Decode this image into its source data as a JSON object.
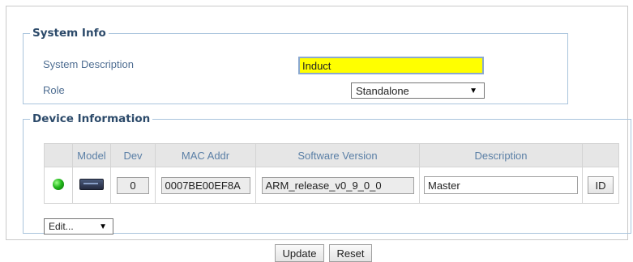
{
  "system_info": {
    "legend": "System Info",
    "system_description_label": "System Description",
    "system_description_value": "Induct",
    "role_label": "Role",
    "role_selected": "Standalone"
  },
  "device_information": {
    "legend": "Device Information",
    "columns": [
      "",
      "Model",
      "Dev",
      "MAC Addr",
      "Software Version",
      "Description",
      ""
    ],
    "rows": [
      {
        "status": "online",
        "status_color": "#22b81b",
        "model_icon": "device-model-icon",
        "dev": "0",
        "mac": "0007BE00EF8A",
        "software_version": "ARM_release_v0_9_0_0",
        "description": "Master",
        "id_button": "ID"
      }
    ],
    "edit_selected": "Edit..."
  },
  "actions": {
    "update_label": "Update",
    "reset_label": "Reset"
  },
  "colors": {
    "highlight": "#ffff00",
    "label_blue": "#4f6e92",
    "legend_blue": "#2c4a6a",
    "border_blue": "#a9c4dc"
  }
}
